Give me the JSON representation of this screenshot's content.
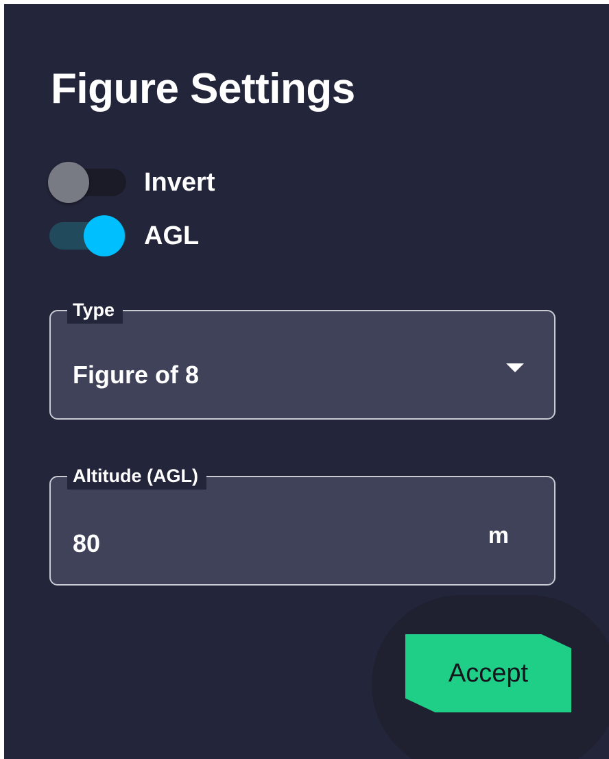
{
  "dialog": {
    "title": "Figure Settings"
  },
  "toggles": [
    {
      "label": "Invert",
      "checked": false
    },
    {
      "label": "AGL",
      "checked": true
    }
  ],
  "type_field": {
    "label": "Type",
    "value": "Figure of 8",
    "icon": "chevron-down-icon"
  },
  "altitude_field": {
    "label": "Altitude (AGL)",
    "value": "80",
    "unit": "m"
  },
  "actions": {
    "accept_label": "Accept"
  },
  "colors": {
    "panel_background": "#23253a",
    "field_background": "#40425a",
    "toggle_on": "#00bfff",
    "toggle_off": "#787a84",
    "accept_button": "#1fcf88"
  }
}
